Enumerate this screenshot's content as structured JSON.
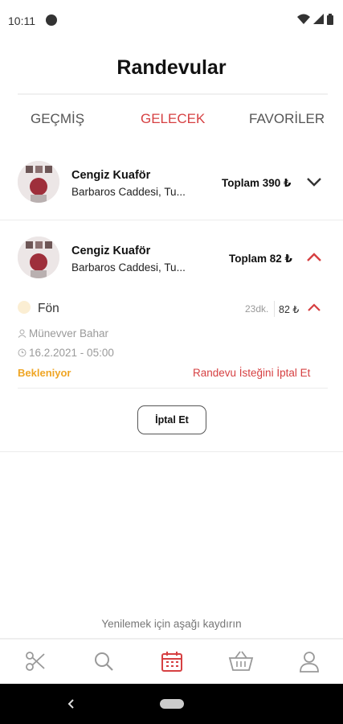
{
  "status_bar": {
    "time": "10:11"
  },
  "header": {
    "title": "Randevular"
  },
  "tabs": [
    {
      "label": "GEÇMİŞ",
      "active": false
    },
    {
      "label": "GELECEK",
      "active": true
    },
    {
      "label": "FAVORİLER",
      "active": false
    }
  ],
  "appointments": [
    {
      "salon_name": "Cengiz Kuaför",
      "address": "Barbaros Caddesi, Tu...",
      "total": "Toplam 390 ₺",
      "expanded": false
    },
    {
      "salon_name": "Cengiz Kuaför",
      "address": "Barbaros Caddesi, Tu...",
      "total": "Toplam 82 ₺",
      "expanded": true,
      "service": {
        "name": "Fön",
        "duration": "23dk.",
        "price": "82 ₺"
      },
      "staff": "Münevver Bahar",
      "datetime": "16.2.2021 - 05:00",
      "status": "Bekleniyor",
      "cancel_request_label": "Randevu İsteğini İptal Et",
      "cancel_button_label": "İptal Et"
    }
  ],
  "refresh_hint": "Yenilemek için aşağı kaydırın",
  "bottom_nav": [
    {
      "icon": "scissors-icon",
      "active": false
    },
    {
      "icon": "search-icon",
      "active": false
    },
    {
      "icon": "calendar-icon",
      "active": true
    },
    {
      "icon": "basket-icon",
      "active": false
    },
    {
      "icon": "user-icon",
      "active": false
    }
  ],
  "colors": {
    "accent": "#d64042",
    "pending": "#efa524",
    "muted": "#9a9a9a"
  }
}
